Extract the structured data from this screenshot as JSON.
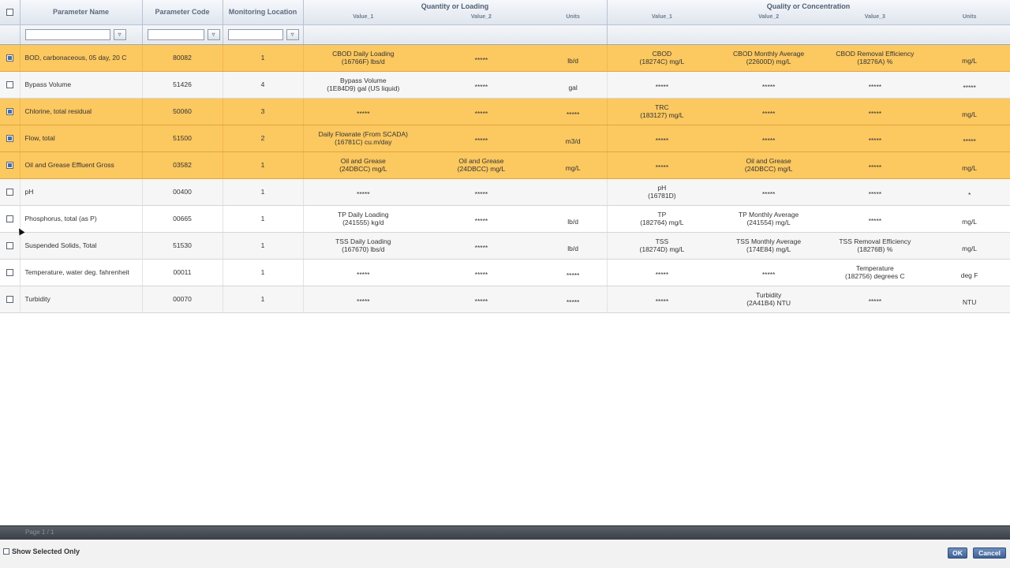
{
  "columns": {
    "select_all": "",
    "param_name": "Parameter Name",
    "param_code": "Parameter Code",
    "monitoring_location": "Monitoring Location",
    "quantity_group": "Quantity or Loading",
    "quality_group": "Quality or Concentration",
    "q_value1": "Value_1",
    "q_value2": "Value_2",
    "q_units": "Units",
    "c_value1": "Value_1",
    "c_value2": "Value_2",
    "c_value3": "Value_3",
    "c_units": "Units"
  },
  "filters": {
    "name_value": "",
    "code_value": "",
    "location_value": "",
    "filter_icon": "funnel-icon"
  },
  "rows": [
    {
      "checked": true,
      "name": "BOD, carbonaceous, 05 day, 20 C",
      "code": "80082",
      "loc": "1",
      "qv1": {
        "lbl": "CBOD Daily Loading",
        "code": "(16766F)    lbs/d"
      },
      "qv2": {
        "lbl": "*****",
        "code": ""
      },
      "qu": "lb/d",
      "cv1": {
        "lbl": "CBOD",
        "code": "(18274C)    mg/L"
      },
      "cv2": {
        "lbl": "CBOD Monthly Average",
        "code": "(22600D)    mg/L"
      },
      "cv3": {
        "lbl": "CBOD Removal Efficiency",
        "code": "(18276A)    %"
      },
      "cu": "mg/L"
    },
    {
      "checked": false,
      "name": "Bypass Volume",
      "code": "51426",
      "loc": "4",
      "qv1": {
        "lbl": "Bypass Volume",
        "code": "(1E84D9)    gal (US liquid)"
      },
      "qv2": {
        "lbl": "*****",
        "code": ""
      },
      "qu": "gal",
      "cv1": {
        "lbl": "*****",
        "code": ""
      },
      "cv2": {
        "lbl": "*****",
        "code": ""
      },
      "cv3": {
        "lbl": "*****",
        "code": ""
      },
      "cu": "*****"
    },
    {
      "checked": true,
      "name": "Chlorine, total residual",
      "code": "50060",
      "loc": "3",
      "qv1": {
        "lbl": "*****",
        "code": ""
      },
      "qv2": {
        "lbl": "*****",
        "code": ""
      },
      "qu": "*****",
      "cv1": {
        "lbl": "TRC",
        "code": "(183127)    mg/L"
      },
      "cv2": {
        "lbl": "*****",
        "code": ""
      },
      "cv3": {
        "lbl": "*****",
        "code": ""
      },
      "cu": "mg/L"
    },
    {
      "checked": true,
      "name": "Flow, total",
      "code": "51500",
      "loc": "2",
      "qv1": {
        "lbl": "Daily Flowrate (From SCADA)",
        "code": "(16781C)    cu.m/day"
      },
      "qv2": {
        "lbl": "*****",
        "code": ""
      },
      "qu": "m3/d",
      "cv1": {
        "lbl": "*****",
        "code": ""
      },
      "cv2": {
        "lbl": "*****",
        "code": ""
      },
      "cv3": {
        "lbl": "*****",
        "code": ""
      },
      "cu": "*****"
    },
    {
      "checked": true,
      "name": "Oil and Grease Effluent Gross",
      "code": "03582",
      "loc": "1",
      "qv1": {
        "lbl": "Oil and Grease",
        "code": "(24DBCC)    mg/L"
      },
      "qv2": {
        "lbl": "Oil and Grease",
        "code": "(24DBCC)    mg/L"
      },
      "qu": "mg/L",
      "cv1": {
        "lbl": "*****",
        "code": ""
      },
      "cv2": {
        "lbl": "Oil and Grease",
        "code": "(24DBCC)    mg/L"
      },
      "cv3": {
        "lbl": "*****",
        "code": ""
      },
      "cu": "mg/L"
    },
    {
      "checked": false,
      "name": "pH",
      "code": "00400",
      "loc": "1",
      "qv1": {
        "lbl": "*****",
        "code": ""
      },
      "qv2": {
        "lbl": "*****",
        "code": ""
      },
      "qu": "",
      "cv1": {
        "lbl": "pH",
        "code": "(16781D)"
      },
      "cv2": {
        "lbl": "*****",
        "code": ""
      },
      "cv3": {
        "lbl": "*****",
        "code": ""
      },
      "cu": "*"
    },
    {
      "checked": false,
      "name": "Phosphorus, total (as P)",
      "code": "00665",
      "loc": "1",
      "qv1": {
        "lbl": "TP Daily Loading",
        "code": "(241555)    kg/d"
      },
      "qv2": {
        "lbl": "*****",
        "code": ""
      },
      "qu": "lb/d",
      "cv1": {
        "lbl": "TP",
        "code": "(182764)    mg/L"
      },
      "cv2": {
        "lbl": "TP Monthly Average",
        "code": "(241554)    mg/L"
      },
      "cv3": {
        "lbl": "*****",
        "code": ""
      },
      "cu": "mg/L"
    },
    {
      "checked": false,
      "name": "Suspended Solids, Total",
      "code": "51530",
      "loc": "1",
      "qv1": {
        "lbl": "TSS Daily Loading",
        "code": "(167670)    lbs/d"
      },
      "qv2": {
        "lbl": "*****",
        "code": ""
      },
      "qu": "lb/d",
      "cv1": {
        "lbl": "TSS",
        "code": "(18274D)    mg/L"
      },
      "cv2": {
        "lbl": "TSS Monthly Average",
        "code": "(174E84)    mg/L"
      },
      "cv3": {
        "lbl": "TSS Removal Efficiency",
        "code": "(18276B)    %"
      },
      "cu": "mg/L"
    },
    {
      "checked": false,
      "name": "Temperature, water deg. fahrenheit",
      "code": "00011",
      "loc": "1",
      "qv1": {
        "lbl": "*****",
        "code": ""
      },
      "qv2": {
        "lbl": "*****",
        "code": ""
      },
      "qu": "*****",
      "cv1": {
        "lbl": "*****",
        "code": ""
      },
      "cv2": {
        "lbl": "*****",
        "code": ""
      },
      "cv3": {
        "lbl": "Temperature",
        "code": "(182756)    degrees C"
      },
      "cu": "deg F"
    },
    {
      "checked": false,
      "name": "Turbidity",
      "code": "00070",
      "loc": "1",
      "qv1": {
        "lbl": "*****",
        "code": ""
      },
      "qv2": {
        "lbl": "*****",
        "code": ""
      },
      "qu": "*****",
      "cv1": {
        "lbl": "*****",
        "code": ""
      },
      "cv2": {
        "lbl": "Turbidity",
        "code": "(2A41B4)    NTU"
      },
      "cv3": {
        "lbl": "*****",
        "code": ""
      },
      "cu": "NTU"
    }
  ],
  "footer": {
    "pager_text": "Page 1 / 1",
    "show_selected_label": "Show Selected Only",
    "ok_label": "OK",
    "cancel_label": "Cancel"
  },
  "colors": {
    "selected_row": "#fcc860",
    "header_bg": "#dfe5ee",
    "button": "#3f6296"
  }
}
